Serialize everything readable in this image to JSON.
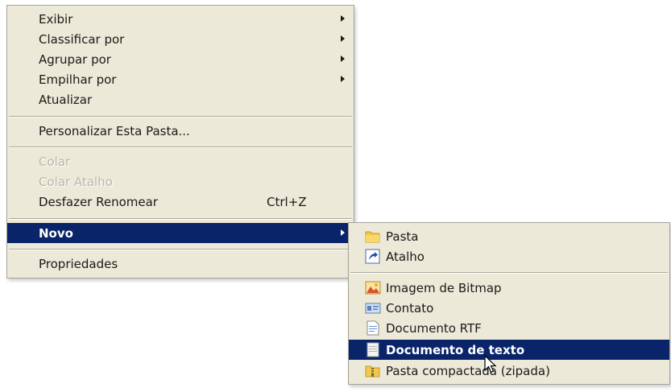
{
  "context_menu": {
    "items": [
      {
        "label": "Exibir",
        "submenu": true
      },
      {
        "label": "Classificar por",
        "submenu": true
      },
      {
        "label": "Agrupar por",
        "submenu": true
      },
      {
        "label": "Empilhar por",
        "submenu": true
      },
      {
        "label": "Atualizar"
      },
      {
        "label": "Personalizar Esta Pasta..."
      },
      {
        "label": "Colar",
        "disabled": true
      },
      {
        "label": "Colar Atalho",
        "disabled": true
      },
      {
        "label": "Desfazer Renomear",
        "shortcut": "Ctrl+Z"
      },
      {
        "label": "Novo",
        "submenu": true,
        "highlighted": true
      },
      {
        "label": "Propriedades"
      }
    ]
  },
  "novo_submenu": {
    "items": [
      {
        "label": "Pasta",
        "icon": "folder-icon"
      },
      {
        "label": "Atalho",
        "icon": "shortcut-icon"
      },
      {
        "label": "Imagem de Bitmap",
        "icon": "bitmap-icon"
      },
      {
        "label": "Contato",
        "icon": "contact-icon"
      },
      {
        "label": "Documento RTF",
        "icon": "rtf-document-icon"
      },
      {
        "label": "Documento de texto",
        "icon": "text-document-icon",
        "highlighted": true
      },
      {
        "label": "Pasta compactada (zipada)",
        "icon": "zip-folder-icon"
      }
    ]
  },
  "colors": {
    "menu_background": "#ece9d8",
    "highlight": "#0a246a",
    "disabled_text": "#b9b6a8"
  }
}
